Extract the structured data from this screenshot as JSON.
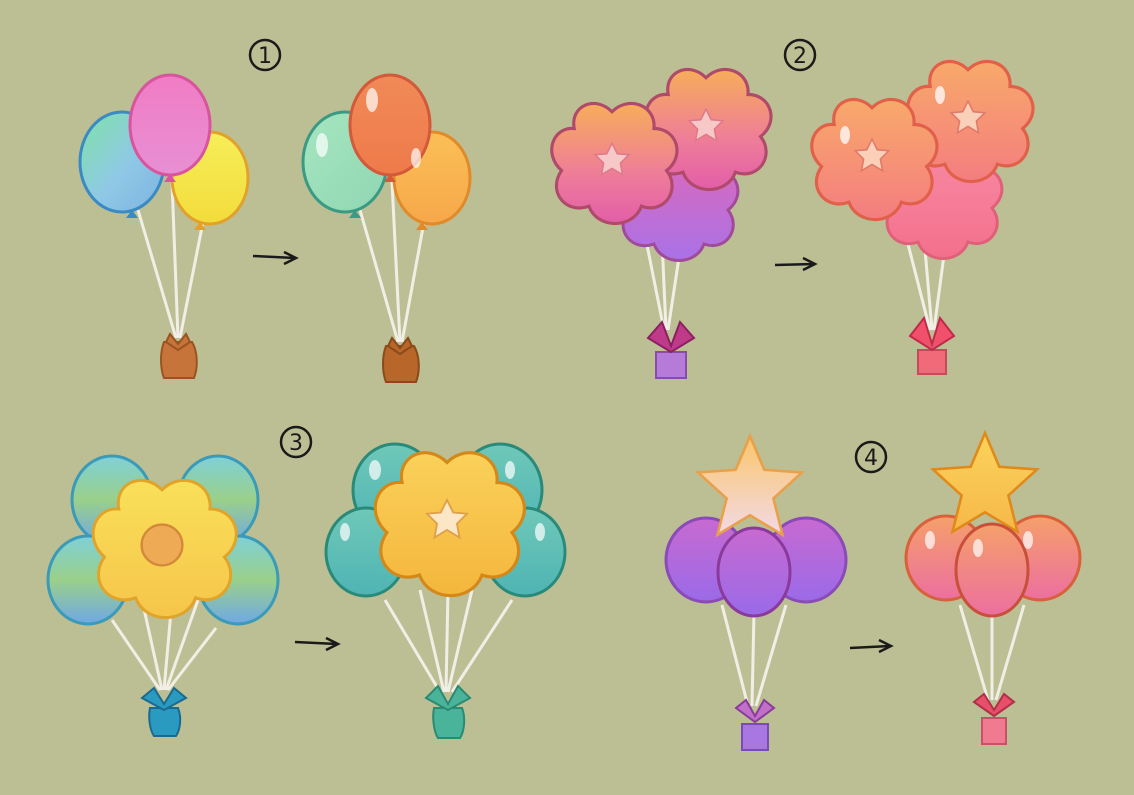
{
  "sections": [
    {
      "number": "1",
      "number_icon": "circled-number-icon"
    },
    {
      "number": "2",
      "number_icon": "circled-number-icon"
    },
    {
      "number": "3",
      "number_icon": "circled-number-icon"
    },
    {
      "number": "4",
      "number_icon": "circled-number-icon"
    }
  ],
  "arrow_icon": "right-arrow-icon",
  "colors": {
    "background": "#bcbf93",
    "string": "#f1eee6",
    "ink": "#1a1a1a"
  }
}
